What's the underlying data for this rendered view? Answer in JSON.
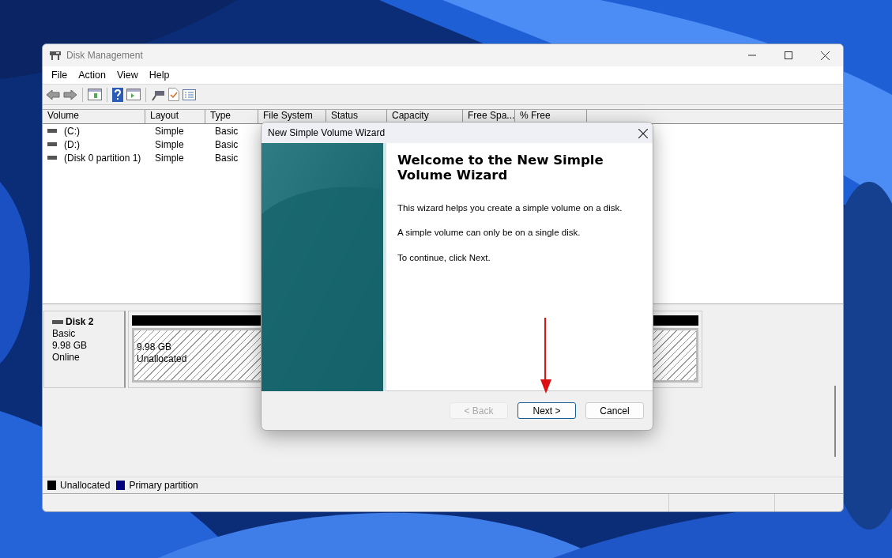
{
  "window": {
    "title": "Disk Management"
  },
  "menu": [
    "File",
    "Action",
    "View",
    "Help"
  ],
  "volume_table": {
    "columns": [
      "Volume",
      "Layout",
      "Type",
      "File System",
      "Status",
      "Capacity",
      "Free Spa...",
      "% Free"
    ],
    "rows": [
      [
        "(C:)",
        "Simple",
        "Basic"
      ],
      [
        "(D:)",
        "Simple",
        "Basic"
      ],
      [
        "(Disk 0 partition 1)",
        "Simple",
        "Basic"
      ]
    ]
  },
  "disk": {
    "name": "Disk 2",
    "type": "Basic",
    "size": "9.98 GB",
    "status": "Online",
    "partition": {
      "size": "9.98 GB",
      "label": "Unallocated",
      "color": "#000000"
    }
  },
  "legend": [
    {
      "label": "Unallocated",
      "color": "#000000"
    },
    {
      "label": "Primary partition",
      "color": "#000080"
    }
  ],
  "dialog": {
    "title": "New Simple Volume Wizard",
    "heading": "Welcome to the New Simple Volume Wizard",
    "paragraphs": [
      "This wizard helps you create a simple volume on a disk.",
      "A simple volume can only be on a single disk.",
      "To continue, click Next."
    ],
    "buttons": [
      {
        "label": "< Back",
        "disabled": true,
        "default": false
      },
      {
        "label": "Next >",
        "disabled": false,
        "default": true
      },
      {
        "label": "Cancel",
        "disabled": false,
        "default": false
      }
    ]
  }
}
